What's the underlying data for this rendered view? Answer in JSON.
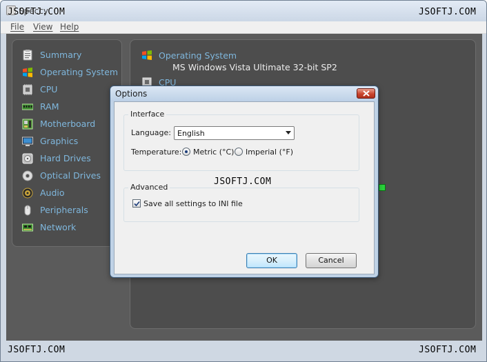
{
  "window": {
    "title": "Speccy"
  },
  "menu": [
    {
      "label": "File"
    },
    {
      "label": "View"
    },
    {
      "label": "Help"
    }
  ],
  "sidebar": {
    "items": [
      {
        "label": "Summary",
        "icon": "summary-icon"
      },
      {
        "label": "Operating System",
        "icon": "windows-logo-icon"
      },
      {
        "label": "CPU",
        "icon": "cpu-icon"
      },
      {
        "label": "RAM",
        "icon": "ram-icon"
      },
      {
        "label": "Motherboard",
        "icon": "motherboard-icon"
      },
      {
        "label": "Graphics",
        "icon": "monitor-icon"
      },
      {
        "label": "Hard Drives",
        "icon": "hard-drive-icon"
      },
      {
        "label": "Optical Drives",
        "icon": "optical-disc-icon"
      },
      {
        "label": "Audio",
        "icon": "speaker-icon"
      },
      {
        "label": "Peripherals",
        "icon": "mouse-icon"
      },
      {
        "label": "Network",
        "icon": "network-icon"
      }
    ]
  },
  "content": {
    "os_title": "Operating System",
    "os_value": "MS Windows Vista Ultimate 32-bit SP2",
    "cpu_title": "CPU"
  },
  "dialog": {
    "title": "Options",
    "interface_group": "Interface",
    "language_label": "Language:",
    "language_value": "English",
    "temperature_label": "Temperature:",
    "metric_label": "Metric (°C)",
    "imperial_label": "Imperial (°F)",
    "metric_selected": true,
    "advanced_group": "Advanced",
    "ini_label": "Save all settings to INI file",
    "ini_checked": true,
    "ok_label": "OK",
    "cancel_label": "Cancel"
  },
  "watermark": "JSOFTJ.COM",
  "colors": {
    "accent_text": "#7fb7dd",
    "panel_bg": "#4d4d4d",
    "status_green": "#29d13a"
  }
}
